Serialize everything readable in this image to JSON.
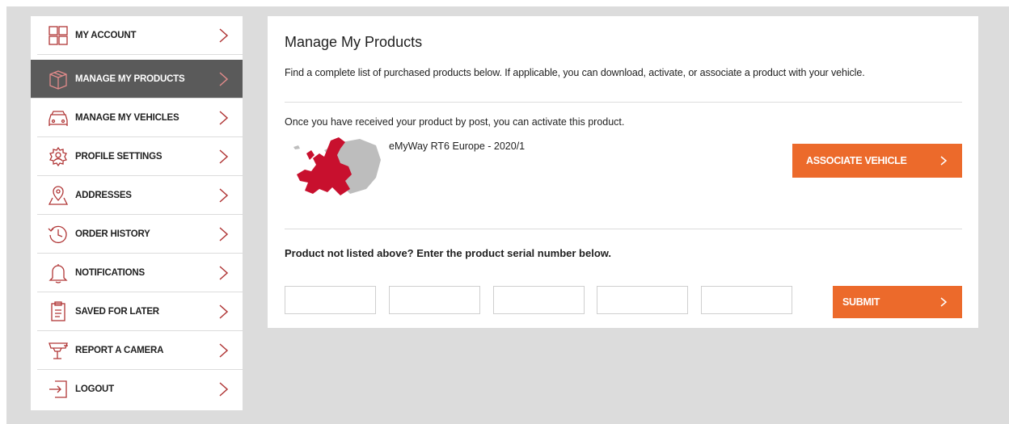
{
  "sidebar": {
    "items": [
      {
        "label": "MY ACCOUNT",
        "icon": "grid-icon"
      },
      {
        "label": "MANAGE MY PRODUCTS",
        "icon": "box-icon",
        "active": true
      },
      {
        "label": "MANAGE MY VEHICLES",
        "icon": "car-icon"
      },
      {
        "label": "PROFILE SETTINGS",
        "icon": "gear-icon"
      },
      {
        "label": "ADDRESSES",
        "icon": "map-pin-icon"
      },
      {
        "label": "ORDER HISTORY",
        "icon": "history-icon"
      },
      {
        "label": "NOTIFICATIONS",
        "icon": "bell-icon"
      },
      {
        "label": "SAVED FOR LATER",
        "icon": "clipboard-icon"
      },
      {
        "label": "REPORT A CAMERA",
        "icon": "camera-icon"
      },
      {
        "label": "LOGOUT",
        "icon": "logout-icon"
      }
    ]
  },
  "main": {
    "title": "Manage My Products",
    "subtitle": "Find a complete list of purchased products below. If applicable, you can download, activate, or associate a product with your vehicle.",
    "notice": "Once you have received your product by post, you can activate this product.",
    "product": {
      "name": "eMyWay RT6 Europe - 2020/1",
      "image_icon": "europe-map-icon",
      "associate_label": "ASSOCIATE VEHICLE"
    },
    "serial": {
      "heading": "Product not listed above? Enter the product serial number below.",
      "fields": [
        "",
        "",
        "",
        "",
        ""
      ],
      "submit_label": "SUBMIT"
    }
  },
  "colors": {
    "accent": "#ec6a2b",
    "active_bg": "#5a5a5a",
    "page_bg": "#dcdcdc",
    "map_red": "#c8102e"
  }
}
